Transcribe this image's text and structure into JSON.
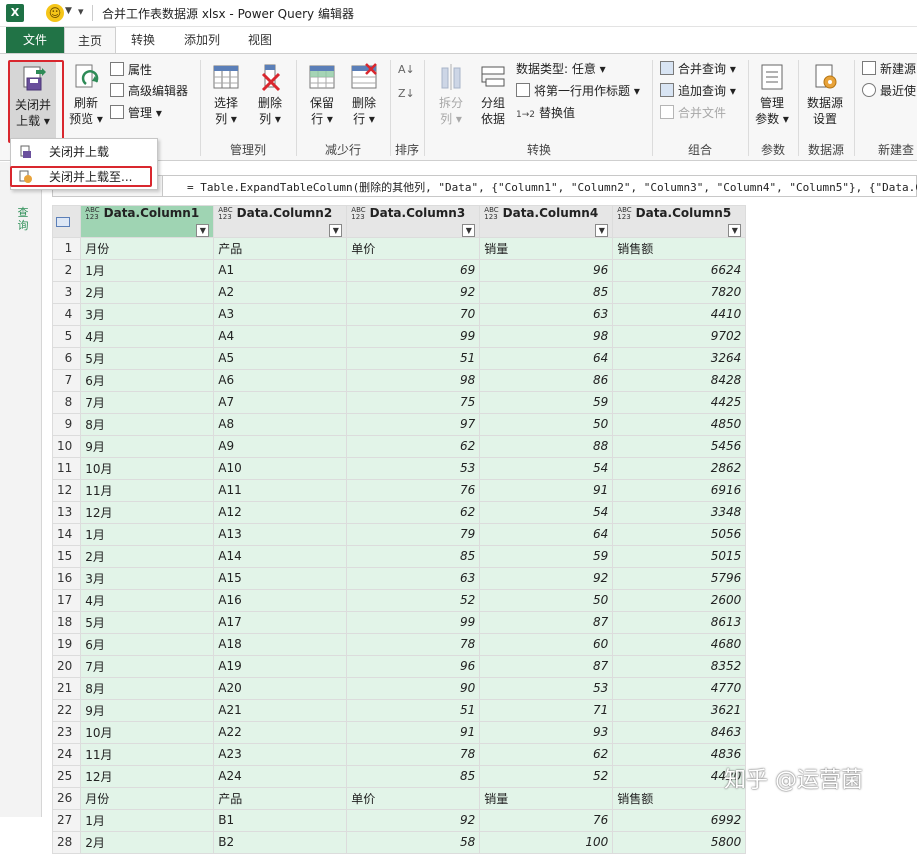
{
  "title_bar": {
    "app_badge": "X",
    "window_title": "合并工作表数据源 xlsx - Power Query 编辑器"
  },
  "tabs": [
    {
      "label": "文件"
    },
    {
      "label": "主页"
    },
    {
      "label": "转换"
    },
    {
      "label": "添加列"
    },
    {
      "label": "视图"
    }
  ],
  "ribbon": {
    "close_load_line1": "关闭并",
    "close_load_line2": "上载",
    "refresh_line1": "刷新",
    "refresh_line2": "预览",
    "properties": "属性",
    "advanced_editor": "高级编辑器",
    "manage": "管理",
    "choose_line1": "选择",
    "choose_line2": "列",
    "remove_line1": "删除",
    "remove_line2": "列",
    "keep_line1": "保留",
    "keep_line2": "行",
    "removerows_line1": "删除",
    "removerows_line2": "行",
    "split_line1": "拆分",
    "split_line2": "列",
    "groupby_line1": "分组",
    "groupby_line2": "依据",
    "data_type": "数据类型: 任意",
    "first_row_header": "将第一行用作标题",
    "replace_values": "替换值",
    "merge_queries": "合并查询",
    "append_queries": "追加查询",
    "combine_files": "合并文件",
    "manage_params_line1": "管理",
    "manage_params_line2": "参数",
    "ds_settings_line1": "数据源",
    "ds_settings_line2": "设置",
    "new_source": "新建源",
    "recent_sources": "最近使",
    "groups": {
      "manage_columns": "管理列",
      "reduce_rows": "减少行",
      "sort": "排序",
      "transform": "转换",
      "combine": "组合",
      "parameters": "参数",
      "data_source": "数据源",
      "new_query": "新建查"
    }
  },
  "dropdown_menu": {
    "items": [
      {
        "label": "关闭并上载"
      },
      {
        "label": "关闭并上载至..."
      }
    ]
  },
  "left_pane": {
    "label": "查询"
  },
  "formula_bar": {
    "text": "= Table.ExpandTableColumn(删除的其他列, \"Data\", {\"Column1\", \"Column2\", \"Column3\", \"Column4\", \"Column5\"}, {\"Data.Co"
  },
  "table": {
    "type_badge_top": "ABC",
    "type_badge_bottom": "123",
    "columns": [
      "Data.Column1",
      "Data.Column2",
      "Data.Column3",
      "Data.Column4",
      "Data.Column5"
    ],
    "rows": [
      [
        "1",
        "月份",
        "产品",
        "单价",
        "销量",
        "销售额"
      ],
      [
        "2",
        "1月",
        "A1",
        "69",
        "96",
        "6624"
      ],
      [
        "3",
        "2月",
        "A2",
        "92",
        "85",
        "7820"
      ],
      [
        "4",
        "3月",
        "A3",
        "70",
        "63",
        "4410"
      ],
      [
        "5",
        "4月",
        "A4",
        "99",
        "98",
        "9702"
      ],
      [
        "6",
        "5月",
        "A5",
        "51",
        "64",
        "3264"
      ],
      [
        "7",
        "6月",
        "A6",
        "98",
        "86",
        "8428"
      ],
      [
        "8",
        "7月",
        "A7",
        "75",
        "59",
        "4425"
      ],
      [
        "9",
        "8月",
        "A8",
        "97",
        "50",
        "4850"
      ],
      [
        "10",
        "9月",
        "A9",
        "62",
        "88",
        "5456"
      ],
      [
        "11",
        "10月",
        "A10",
        "53",
        "54",
        "2862"
      ],
      [
        "12",
        "11月",
        "A11",
        "76",
        "91",
        "6916"
      ],
      [
        "13",
        "12月",
        "A12",
        "62",
        "54",
        "3348"
      ],
      [
        "14",
        "1月",
        "A13",
        "79",
        "64",
        "5056"
      ],
      [
        "15",
        "2月",
        "A14",
        "85",
        "59",
        "5015"
      ],
      [
        "16",
        "3月",
        "A15",
        "63",
        "92",
        "5796"
      ],
      [
        "17",
        "4月",
        "A16",
        "52",
        "50",
        "2600"
      ],
      [
        "18",
        "5月",
        "A17",
        "99",
        "87",
        "8613"
      ],
      [
        "19",
        "6月",
        "A18",
        "78",
        "60",
        "4680"
      ],
      [
        "20",
        "7月",
        "A19",
        "96",
        "87",
        "8352"
      ],
      [
        "21",
        "8月",
        "A20",
        "90",
        "53",
        "4770"
      ],
      [
        "22",
        "9月",
        "A21",
        "51",
        "71",
        "3621"
      ],
      [
        "23",
        "10月",
        "A22",
        "91",
        "93",
        "8463"
      ],
      [
        "24",
        "11月",
        "A23",
        "78",
        "62",
        "4836"
      ],
      [
        "25",
        "12月",
        "A24",
        "85",
        "52",
        "4420"
      ],
      [
        "26",
        "月份",
        "产品",
        "单价",
        "销量",
        "销售额"
      ],
      [
        "27",
        "1月",
        "B1",
        "92",
        "76",
        "6992"
      ],
      [
        "28",
        "2月",
        "B2",
        "58",
        "100",
        "5800"
      ]
    ]
  },
  "watermark": "知乎 @运营菌",
  "colors": {
    "file_tab": "#217346",
    "selected_col_header": "#9fd4b3",
    "cell_bg": "#e2f4e8",
    "highlight": "#d9272e"
  }
}
